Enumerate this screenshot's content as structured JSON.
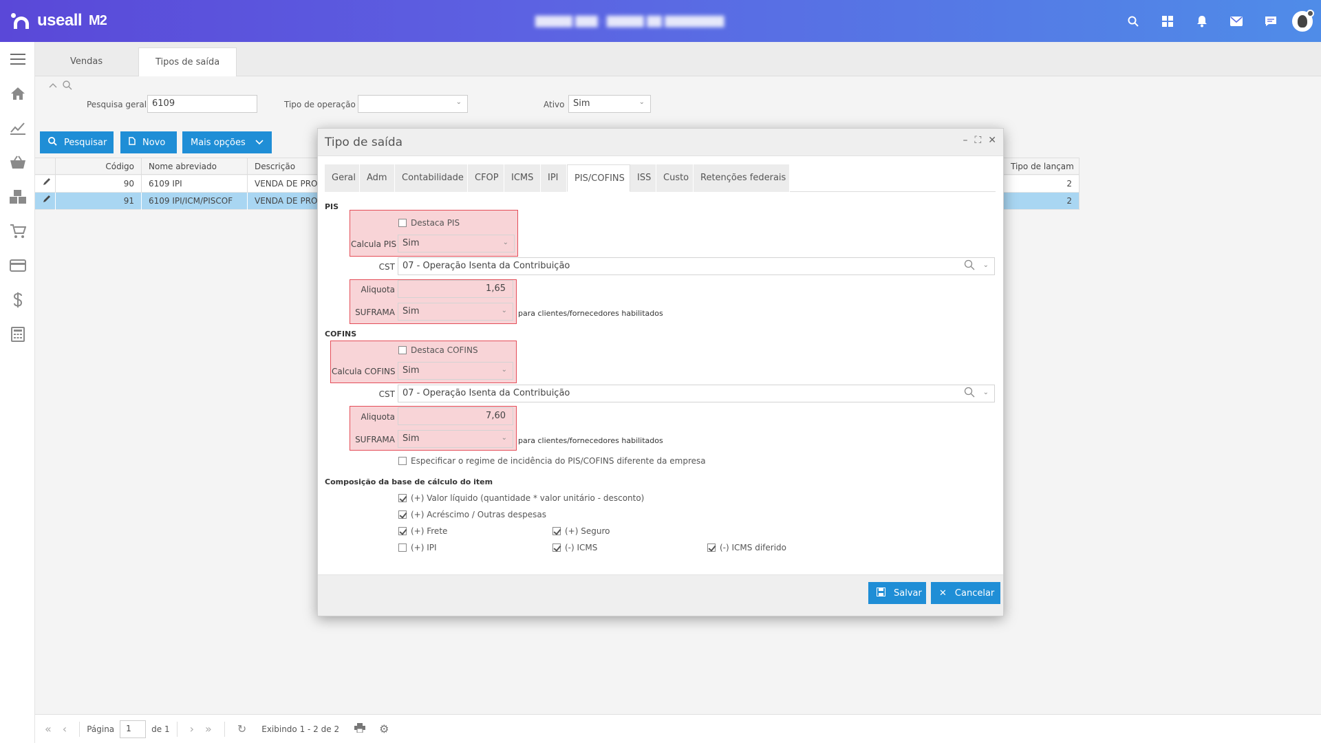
{
  "header": {
    "logo_text": "useall",
    "logo_suffix": "M2",
    "user_info": "█████ ███ · █████ ██ ████████",
    "icons": [
      "search-icon",
      "grid-icon",
      "bell-icon",
      "mail-icon",
      "chat-icon",
      "avatar"
    ]
  },
  "sidebar": {
    "items": [
      "menu-icon",
      "home-icon",
      "chart-icon",
      "basket-icon",
      "boxes-icon",
      "cart-icon",
      "card-icon",
      "dollar-icon",
      "calculator-icon"
    ]
  },
  "page_tabs": [
    {
      "label": "Vendas"
    },
    {
      "label": "Tipos de saída"
    }
  ],
  "filter": {
    "search_label": "Pesquisa geral",
    "search_value": "6109",
    "tipo_label": "Tipo de operação",
    "tipo_value": "",
    "ativo_label": "Ativo",
    "ativo_value": "Sim"
  },
  "actions": {
    "search": "Pesquisar",
    "new": "Novo",
    "more": "Mais opções"
  },
  "grid": {
    "columns": [
      "Código",
      "Nome abreviado",
      "Descrição",
      "Tipo de lançam"
    ],
    "rows": [
      {
        "codigo": "90",
        "nome": "6109 IPI",
        "descricao": "VENDA DE PRODUÇ",
        "tipo": "2"
      },
      {
        "codigo": "91",
        "nome": "6109 IPI/ICM/PISCOF",
        "descricao": "VENDA DE PRODUÇ",
        "tipo": "2"
      }
    ]
  },
  "pager": {
    "page_label": "Página",
    "page_value": "1",
    "of_label": "de 1",
    "showing": "Exibindo 1 - 2 de 2"
  },
  "modal": {
    "title": "Tipo de saída",
    "tabs": [
      "Geral",
      "Adm",
      "Contabilidade",
      "CFOP",
      "ICMS",
      "IPI",
      "PIS/COFINS",
      "ISS",
      "Custo",
      "Retenções federais"
    ],
    "pis": {
      "section": "PIS",
      "destaca": "Destaca PIS",
      "calcula_label": "Calcula PIS",
      "calcula_value": "Sim",
      "cst_label": "CST",
      "cst_value": "07 - Operação Isenta da Contribuição",
      "aliquota_label": "Aliquota",
      "aliquota_value": "1,65",
      "suframa_label": "SUFRAMA",
      "suframa_value": "Sim",
      "suframa_note": "para clientes/fornecedores habilitados"
    },
    "cofins": {
      "section": "COFINS",
      "destaca": "Destaca COFINS",
      "calcula_label": "Calcula COFINS",
      "calcula_value": "Sim",
      "cst_label": "CST",
      "cst_value": "07 - Operação Isenta da Contribuição",
      "aliquota_label": "Aliquota",
      "aliquota_value": "7,60",
      "suframa_label": "SUFRAMA",
      "suframa_value": "Sim",
      "suframa_note": "para clientes/fornecedores habilitados"
    },
    "regime": "Especificar o regime de incidência do PIS/COFINS diferente da empresa",
    "base_title": "Composição da base de cálculo do item",
    "base": {
      "valor_liquido": "(+) Valor líquido (quantidade * valor unitário - desconto)",
      "acrescimo": "(+) Acréscimo / Outras despesas",
      "frete": "(+) Frete",
      "seguro": "(+) Seguro",
      "ipi": "(+) IPI",
      "icms": "(-) ICMS",
      "icms_diferido": "(-) ICMS diferido"
    },
    "save": "Salvar",
    "cancel": "Cancelar"
  }
}
